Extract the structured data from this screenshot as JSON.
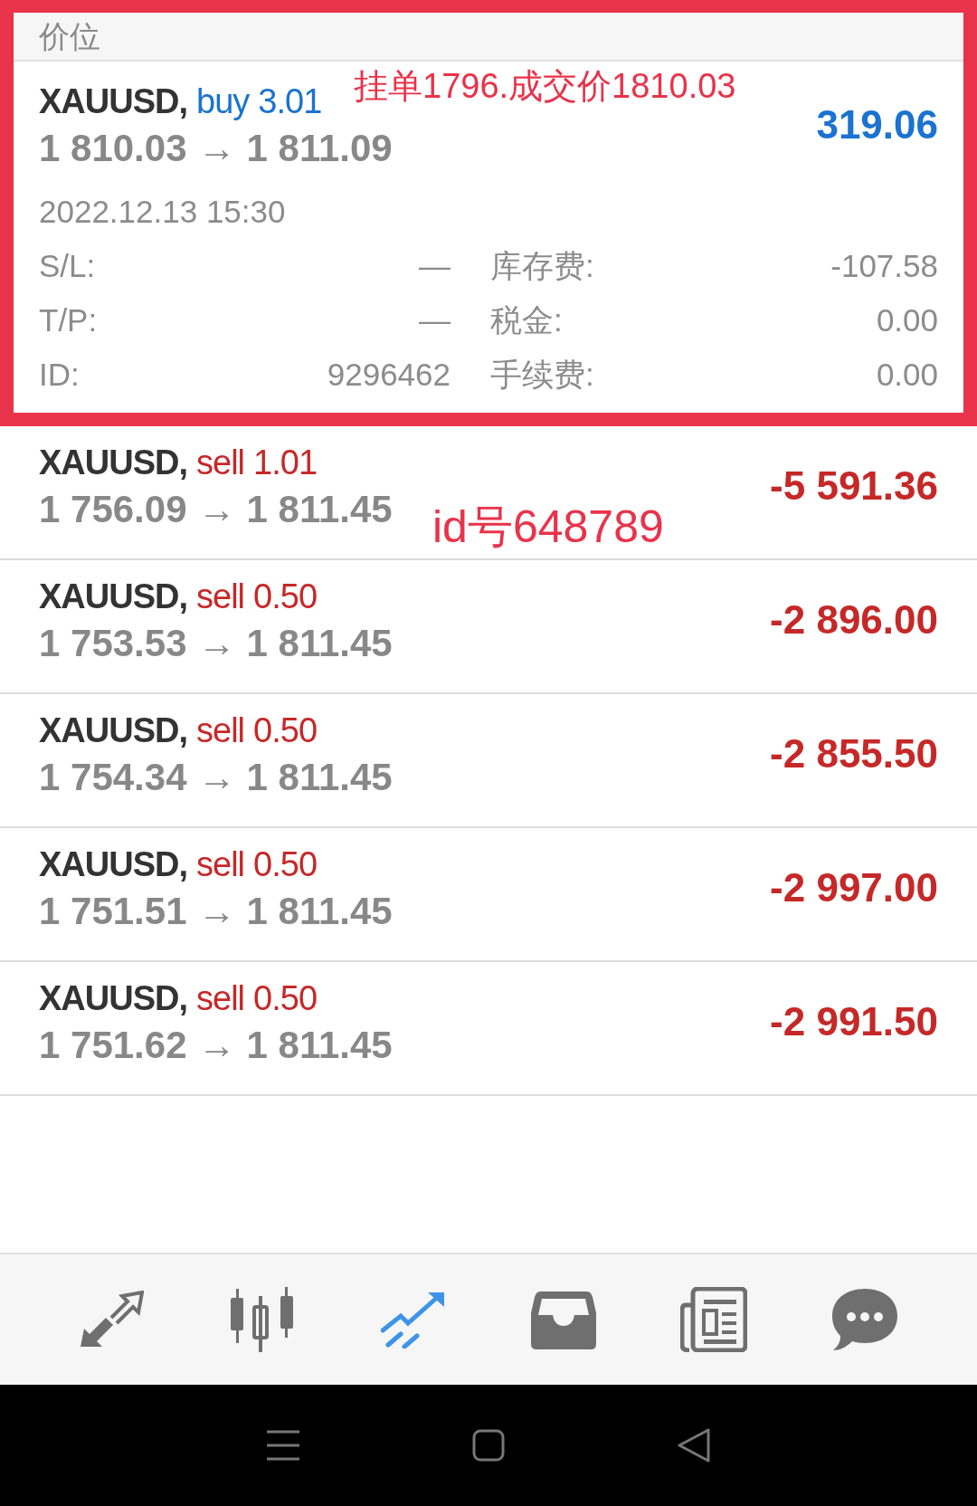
{
  "highlight_frame": true,
  "header": {
    "title": "价位"
  },
  "annotations": [
    {
      "text": "挂单1796.成交价1810.03"
    },
    {
      "text": "id号648789"
    }
  ],
  "positions": [
    {
      "symbol": "XAUUSD,",
      "side": "buy",
      "volume": "3.01",
      "open_price": "1 810.03",
      "arrow": "→",
      "current_price": "1 811.09",
      "profit": "319.06",
      "time": "2022.12.13 15:30",
      "details": [
        {
          "label": "S/L:",
          "value": "—",
          "label2": "库存费:",
          "value2": "-107.58"
        },
        {
          "label": "T/P:",
          "value": "—",
          "label2": "税金:",
          "value2": "0.00"
        },
        {
          "label": "ID:",
          "value": "9296462",
          "label2": "手续费:",
          "value2": "0.00"
        }
      ]
    },
    {
      "symbol": "XAUUSD,",
      "side": "sell",
      "volume": "1.01",
      "open_price": "1 756.09",
      "arrow": "→",
      "current_price": "1 811.45",
      "profit": "-5 591.36"
    },
    {
      "symbol": "XAUUSD,",
      "side": "sell",
      "volume": "0.50",
      "open_price": "1 753.53",
      "arrow": "→",
      "current_price": "1 811.45",
      "profit": "-2 896.00"
    },
    {
      "symbol": "XAUUSD,",
      "side": "sell",
      "volume": "0.50",
      "open_price": "1 754.34",
      "arrow": "→",
      "current_price": "1 811.45",
      "profit": "-2 855.50"
    },
    {
      "symbol": "XAUUSD,",
      "side": "sell",
      "volume": "0.50",
      "open_price": "1 751.51",
      "arrow": "→",
      "current_price": "1 811.45",
      "profit": "-2 997.00"
    },
    {
      "symbol": "XAUUSD,",
      "side": "sell",
      "volume": "0.50",
      "open_price": "1 751.62",
      "arrow": "→",
      "current_price": "1 811.45",
      "profit": "-2 991.50"
    }
  ],
  "nav": [
    {
      "kind": "quotes",
      "selected": false
    },
    {
      "kind": "chart",
      "selected": false
    },
    {
      "kind": "trade",
      "selected": true
    },
    {
      "kind": "history",
      "selected": false
    },
    {
      "kind": "news",
      "selected": false
    },
    {
      "kind": "chat",
      "selected": false
    }
  ]
}
